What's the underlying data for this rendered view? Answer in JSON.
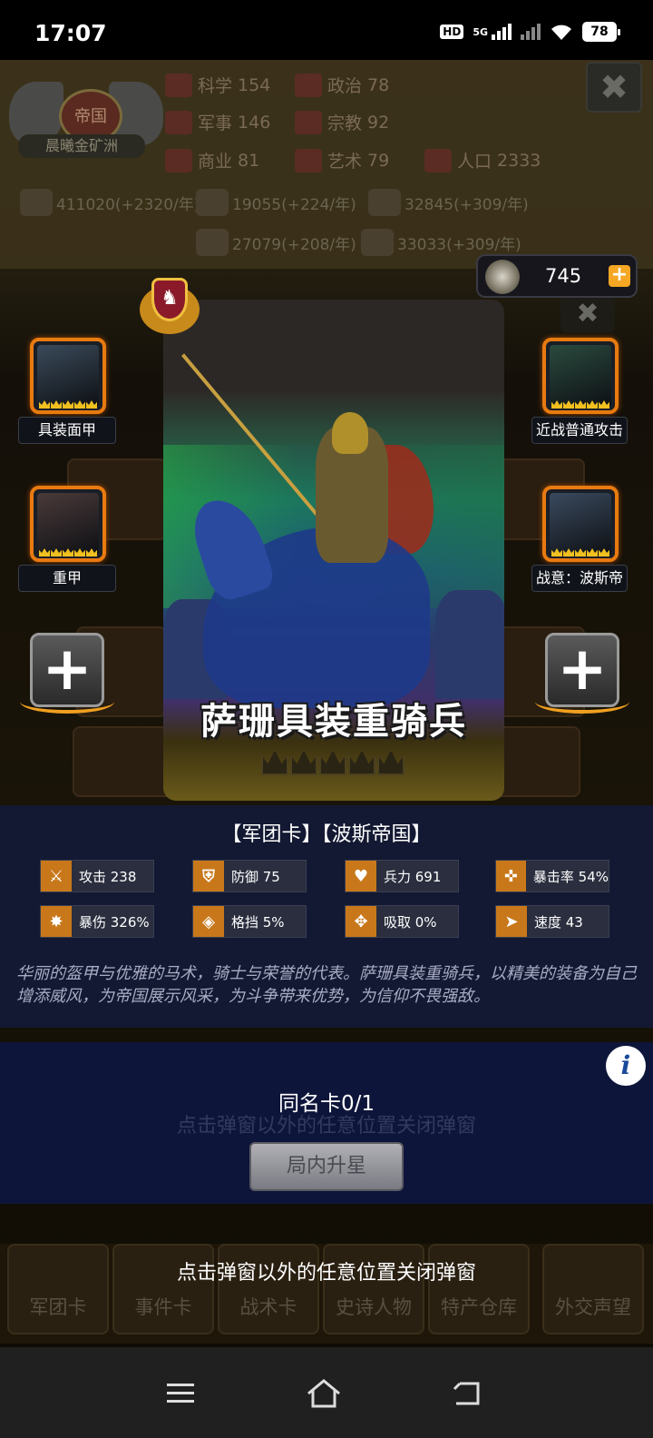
{
  "status_bar": {
    "time": "17:07",
    "hd_label": "HD",
    "network_label": "5G",
    "battery": "78"
  },
  "background": {
    "emblem_title": "帝国",
    "emblem_name": "晨曦金矿洲",
    "stats": [
      {
        "label": "科学",
        "value": "154"
      },
      {
        "label": "政治",
        "value": "78"
      },
      {
        "label": "军事",
        "value": "146"
      },
      {
        "label": "宗教",
        "value": "92"
      },
      {
        "label": "商业",
        "value": "81"
      },
      {
        "label": "艺术",
        "value": "79"
      },
      {
        "label": "人口",
        "value": "2333"
      }
    ],
    "resources": [
      "411020(+2320/年)",
      "19055(+224/年)",
      "32845(+309/年)",
      "27079(+208/年)",
      "33033(+309/年)"
    ],
    "tabs": [
      "军团卡",
      "事件卡",
      "战术卡",
      "史诗人物",
      "特产仓库",
      "外交声望"
    ],
    "close_glyph": "✖"
  },
  "currency": {
    "value": "745",
    "plus": "+"
  },
  "card": {
    "name": "萨珊具装重骑兵",
    "stars": 5,
    "rank_glyph": "♞"
  },
  "skills": [
    {
      "label": "具装面甲",
      "stars": 5,
      "color": "#3a4a5a"
    },
    {
      "label": "近战普通攻击",
      "stars": 5,
      "color": "#2a4a3e"
    },
    {
      "label": "重甲",
      "stars": 5,
      "color": "#4a3a3a"
    },
    {
      "label": "战意：波斯帝",
      "stars": 5,
      "color": "#3a4a5e"
    }
  ],
  "add_glyph": "+",
  "info": {
    "tags": "【军团卡】【波斯帝国】",
    "stats": [
      {
        "name": "attack",
        "text": "攻击 238"
      },
      {
        "name": "defense",
        "text": "防御 75"
      },
      {
        "name": "troops",
        "text": "兵力 691"
      },
      {
        "name": "crit-rate",
        "text": "暴击率 54%"
      },
      {
        "name": "crit-damage",
        "text": "暴伤 326%"
      },
      {
        "name": "block",
        "text": "格挡 5%"
      },
      {
        "name": "absorb",
        "text": "吸取 0%"
      },
      {
        "name": "speed",
        "text": "速度 43"
      }
    ],
    "description": "华丽的盔甲与优雅的马术，骑士与荣誉的代表。萨珊具装重骑兵，以精美的装备为自己增添威风，为帝国展示风采，为斗争带来优势，为信仰不畏强敌。"
  },
  "upgrade": {
    "same_card": "同名卡0/1",
    "button": "局内升星",
    "info_glyph": "i"
  },
  "close_hint": "点击弹窗以外的任意位置关闭弹窗",
  "colors": {
    "accent_orange": "#e87a10",
    "star_gold": "#f0c020",
    "panel_blue": "#141a34"
  }
}
